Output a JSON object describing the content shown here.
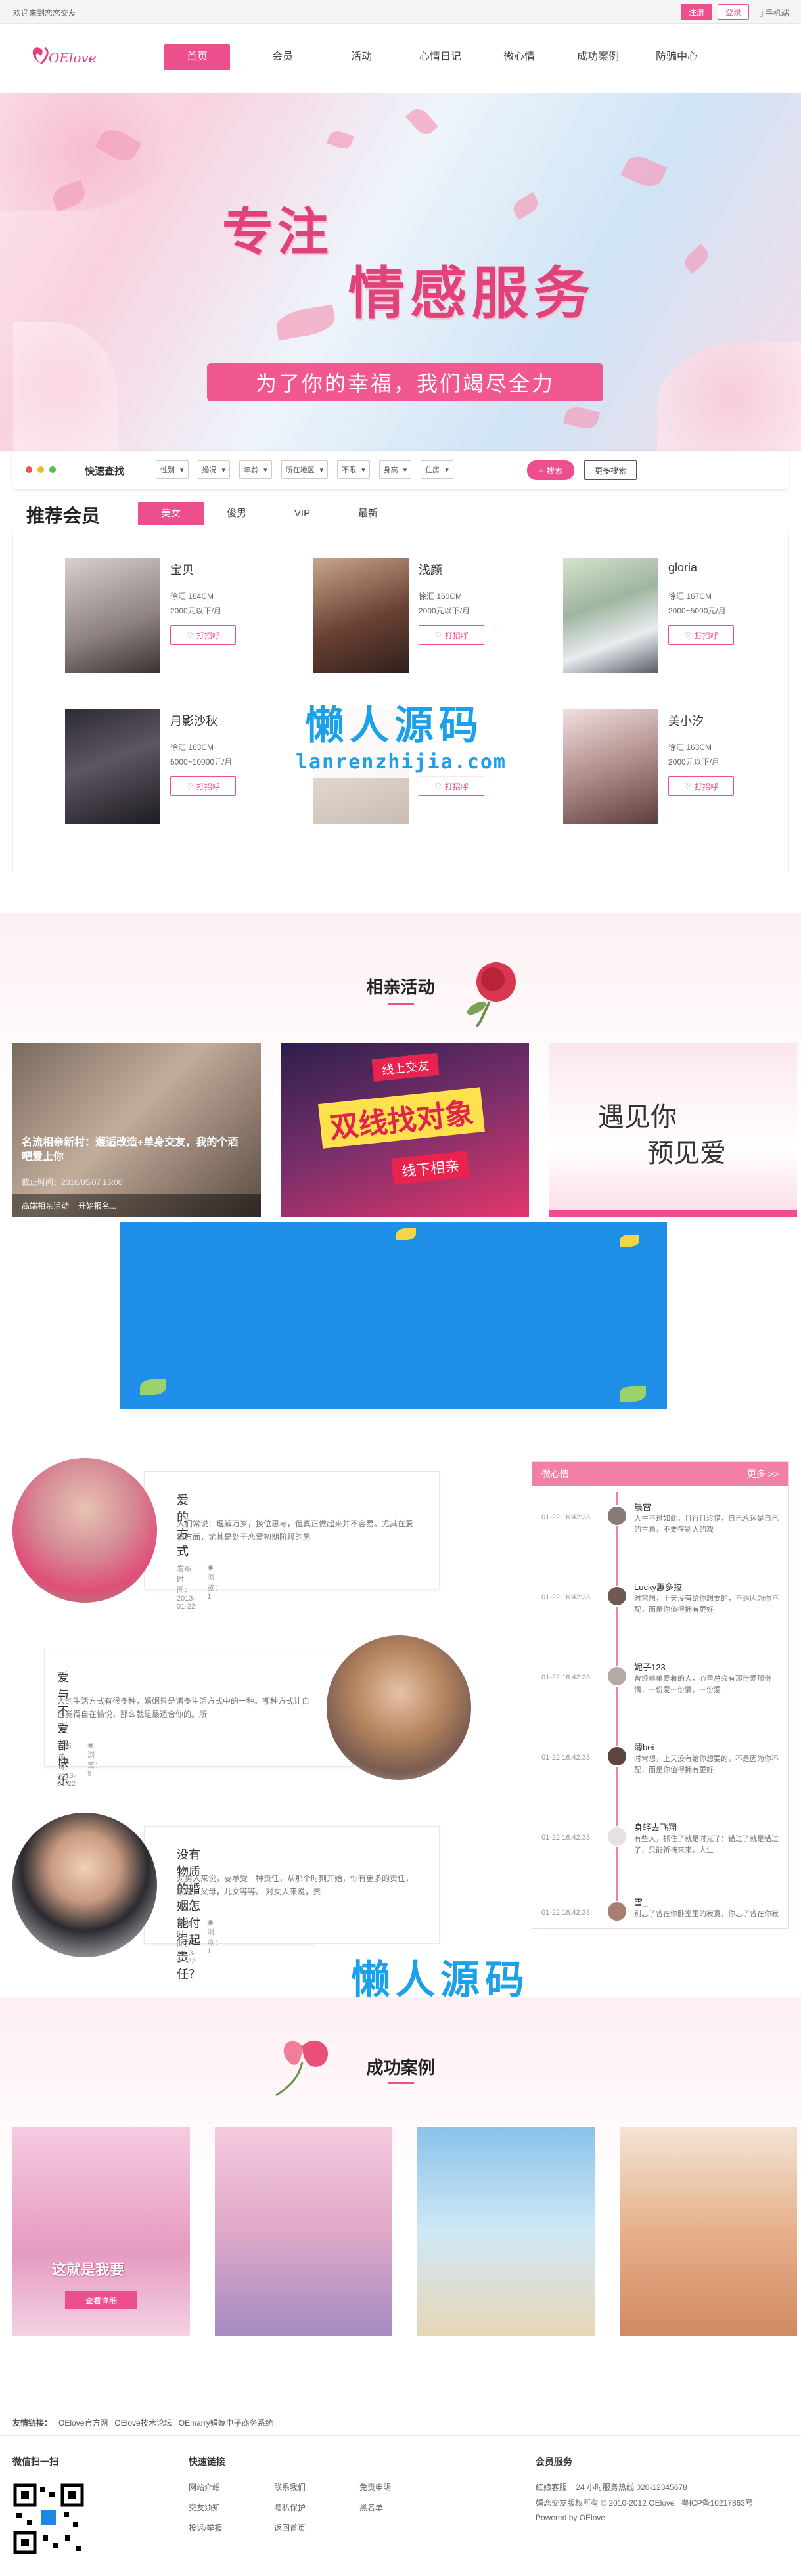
{
  "topbar": {
    "welcome": "欢迎来到恋恋交友",
    "register": "注册",
    "login": "登录",
    "mobile": "手机端"
  },
  "header": {
    "logo_text": "OElove",
    "nav": [
      "首页",
      "会员",
      "活动",
      "心情日记",
      "微心情",
      "成功案例",
      "防骗中心"
    ]
  },
  "banner": {
    "line1": "专注",
    "line2": "情感服务",
    "subtitle": "为了你的幸福，我们竭尽全力"
  },
  "quick_search": {
    "label": "快速查找",
    "selects": [
      "性别",
      "婚况",
      "年龄",
      "所在地区",
      "不限",
      "身高",
      "住房"
    ],
    "search": "搜索",
    "more": "更多搜索"
  },
  "recommend": {
    "title": "推荐会员",
    "tabs": [
      "美女",
      "俊男",
      "VIP",
      "最新"
    ],
    "greet_label": "打招呼",
    "members": [
      {
        "name": "宝贝",
        "line1": "徐汇 164CM",
        "line2": "2000元以下/月"
      },
      {
        "name": "浅颜",
        "line1": "徐汇 160CM",
        "line2": "2000元以下/月"
      },
      {
        "name": "gloria",
        "line1": "徐汇 167CM",
        "line2": "2000~5000元/月"
      },
      {
        "name": "月影沙秋",
        "line1": "徐汇 163CM",
        "line2": "5000~10000元/月"
      },
      {
        "name": "",
        "line1": "",
        "line2": ""
      },
      {
        "name": "美小汐",
        "line1": "徐汇 163CM",
        "line2": "2000元以下/月"
      }
    ]
  },
  "watermark": {
    "big": "懒人源码",
    "small": "lanrenzhijia.com"
  },
  "activities": {
    "title": "相亲活动",
    "cards": [
      {
        "caption": "名流相亲新村：邂逅改造+单身交友，我的个酒吧爱上你",
        "meta": "截止时间：2018/05/07 15:00",
        "foot1": "高端相亲活动",
        "foot2": "开始报名..."
      },
      {
        "caption": "",
        "meta": "",
        "foot1": "",
        "foot2": ""
      },
      {
        "caption": "",
        "meta": "",
        "foot1": "",
        "foot2": ""
      }
    ],
    "card2_big": "双线找对象",
    "card2_top": "线上交友",
    "card2_bottom": "线下相亲",
    "card3_line1": "遇见你",
    "card3_line2": "预见爱"
  },
  "stories": [
    {
      "title": "爱的方式",
      "body": "人们常说：理解万岁，换位思考，但真正做起来并不容易。尤其在爱情方面，尤其是处于恋爱初期阶段的男",
      "date": "发布时间：2013-01-22",
      "views": "浏览：1"
    },
    {
      "title": "爱与不爱都快乐",
      "body": "人的生活方式有很多种，婚姻只是诸多生活方式中的一种。哪种方式让自己觉得自在愉悦，那么就是最适合你的。所",
      "date": "发布时间：2013-01-22",
      "views": "浏览：9"
    },
    {
      "title": "没有物质的婚姻怎能付得起责任？",
      "body": "对男人来说，要承受一种责任，从那个时刻开始，你有更多的责任，家庭，父母，儿女等等。    对女人来说，责",
      "date": "发布时间：2013-01-22",
      "views": "浏览：1"
    }
  ],
  "mood": {
    "title": "微心情",
    "more": "更多 >>",
    "items": [
      {
        "time": "01-22 16:42:33",
        "name": "晨雷",
        "text": "人生不过如此，且行且珍惜，自己永远是自己的主角，不要在别人的戏"
      },
      {
        "time": "01-22 16:42:33",
        "name": "Lucky蕙多拉",
        "text": "时常想，上天没有给你想要的，不是因为你不配，而是你值得拥有更好"
      },
      {
        "time": "01-22 16:42:33",
        "name": "妮子123",
        "text": "曾经单单爱着的人，心里总会有那份爱那份情，一份爱一份情，一份爱"
      },
      {
        "time": "01-22 16:42:33",
        "name": "薄bei",
        "text": "时常想，上天没有给你想要的，不是因为你不配，而是你值得拥有更好"
      },
      {
        "time": "01-22 16:42:33",
        "name": "身轻去飞翔",
        "text": "有些人，抓住了就是时光了；错过了就是错过了，只能祈祷来来。人生"
      },
      {
        "time": "01-22 16:42:33",
        "name": "雪_",
        "text": "别忘了曾在你卧室里的寂寞，你忘了曾在你寂寞的夜里，无论有多"
      }
    ]
  },
  "cases": {
    "title": "成功案例",
    "card1_text": "这就是我要",
    "card1_btn": "查看详细"
  },
  "footer": {
    "friends_label": "友情链接：",
    "friends": [
      "OElove官方网",
      "OElove技术论坛",
      "OEmarry婚嫁电子商务系统"
    ],
    "col1_title": "微信扫一扫",
    "col2_title": "快速链接",
    "col2_links": [
      "网站介绍",
      "联系我们",
      "免责申明",
      "交友须知",
      "隐私保护",
      "黑名单",
      "投诉/举报",
      "返回首页"
    ],
    "col3_title": "会员服务",
    "service": "红娘客服    24 小时服务热线 020-12345678",
    "copyright": "婚恋交友版权所有 © 2010-2012 OElove   粤ICP备10217863号",
    "powered": "Powered by OElove"
  },
  "colors": {
    "accent": "#ec4f8c",
    "mood_head": "#f27fa6",
    "watermark": "#1ba0ea"
  }
}
